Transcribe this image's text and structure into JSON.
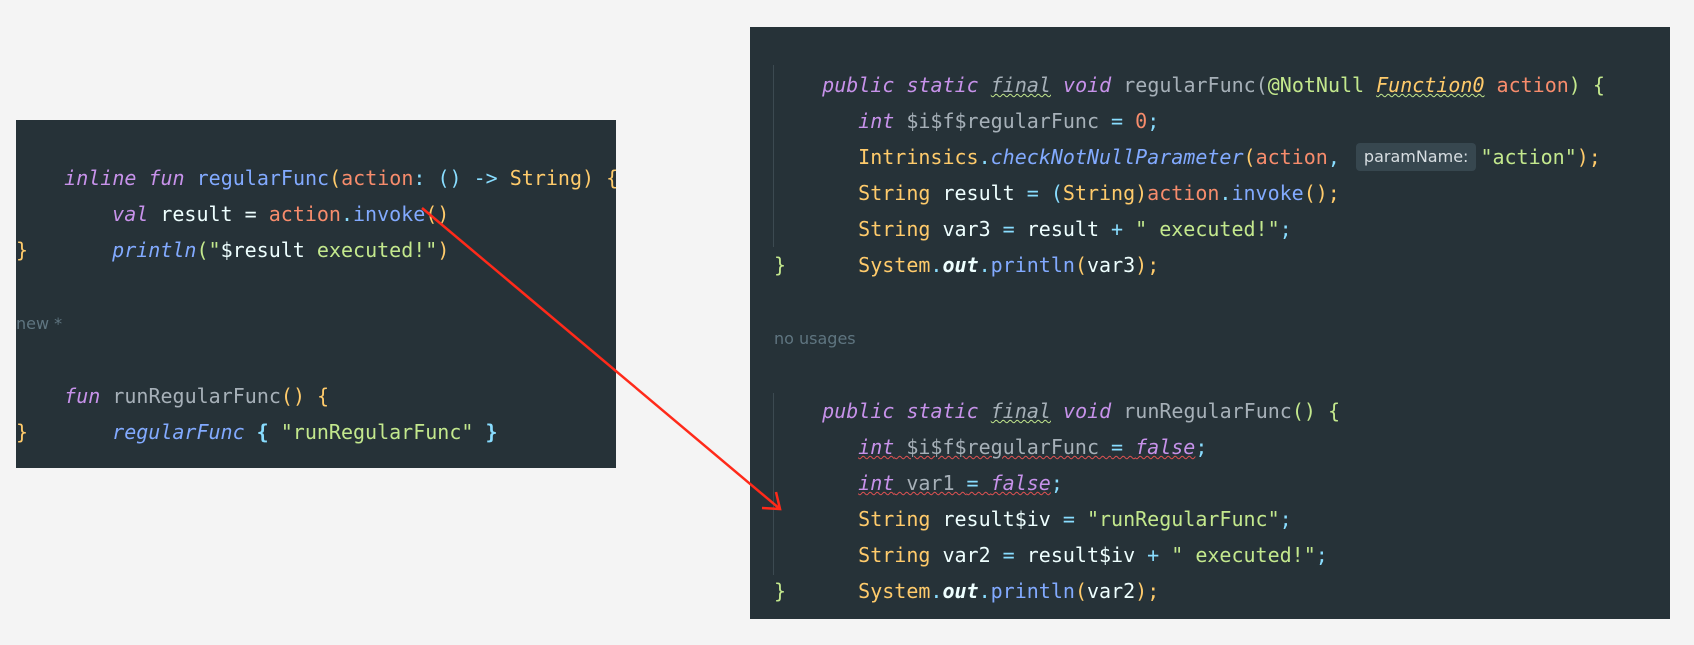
{
  "left": {
    "l1": {
      "a": "inline",
      "b": " ",
      "c": "fun",
      "d": " ",
      "e": "regularFunc",
      "f": "(",
      "g": "action",
      "h": ": () ",
      "i": "->",
      "j": " String",
      "k": ") {"
    },
    "l2": {
      "a": "val",
      "b": " result = ",
      "c": "action",
      "d": ".",
      "e": "invoke",
      "f": "()"
    },
    "l3": {
      "a": "println",
      "b": "(\"",
      "c": "$result",
      "d": " executed!\"",
      "e": ")"
    },
    "l4": {
      "a": "}"
    },
    "hint": "new *",
    "l6": {
      "a": "fun",
      "b": " ",
      "c": "runRegularFunc",
      "d": "() {"
    },
    "l7": {
      "a": "regularFunc",
      "b": " { ",
      "c": "\"runRegularFunc\"",
      "d": " }"
    },
    "l8": {
      "a": "}"
    }
  },
  "right": {
    "r1": {
      "a": "public",
      "b": " ",
      "c": "static",
      "d": " ",
      "e": "final",
      "f": " ",
      "g": "void",
      "h": " regularFunc(",
      "i": "@NotNull",
      "j": " ",
      "k": "Function0",
      "l": " ",
      "m": "action",
      "n": ") {"
    },
    "r2": {
      "a": "int",
      "b": " $i$f$regularFunc ",
      "c": "= ",
      "d": "0",
      "e": ";"
    },
    "r3": {
      "a": "Intrinsics",
      "b": ".",
      "c": "checkNotNullParameter",
      "d": "(",
      "e": "action",
      "f": ", ",
      "chip": "paramName:",
      "g": "\"action\"",
      "h": ");"
    },
    "r4": {
      "a": "String",
      "b": " result ",
      "c": "= (",
      "d": "String",
      "e": ")",
      "f": "action",
      "g": ".",
      "h": "invoke",
      "i": "();"
    },
    "r5": {
      "a": "String",
      "b": " var3 ",
      "c": "=",
      "d": " result ",
      "e": "+",
      "f": " \" executed!\"",
      "g": ";"
    },
    "r6": {
      "a": "System",
      "b": ".",
      "c": "out",
      "d": ".",
      "e": "println",
      "f": "(",
      "g": "var3",
      "h": ");"
    },
    "r7": {
      "a": "}"
    },
    "hint": "no usages",
    "r9": {
      "a": "public",
      "b": " ",
      "c": "static",
      "d": " ",
      "e": "final",
      "f": " ",
      "g": "void",
      "h": " runRegularFunc",
      "i": "() {"
    },
    "r10": {
      "a": "int",
      "b": " $i$f$regularFunc ",
      "c": "= ",
      "d": "false",
      "e": ";"
    },
    "r11": {
      "a": "int",
      "b": " var1 ",
      "c": "= ",
      "d": "false",
      "e": ";"
    },
    "r12": {
      "a": "String",
      "b": " result$iv ",
      "c": "=",
      "d": " \"runRegularFunc\"",
      "e": ";"
    },
    "r13": {
      "a": "String",
      "b": " var2 ",
      "c": "=",
      "d": " result$iv ",
      "e": "+",
      "f": " \" executed!\"",
      "g": ";"
    },
    "r14": {
      "a": "System",
      "b": ".",
      "c": "out",
      "d": ".",
      "e": "println",
      "f": "(",
      "g": "var2",
      "h": ");"
    },
    "r15": {
      "a": "}"
    }
  },
  "colors": {
    "arrow": "#ff2a1a",
    "editor_bg": "#263238",
    "page_bg": "#f4f4f4"
  }
}
